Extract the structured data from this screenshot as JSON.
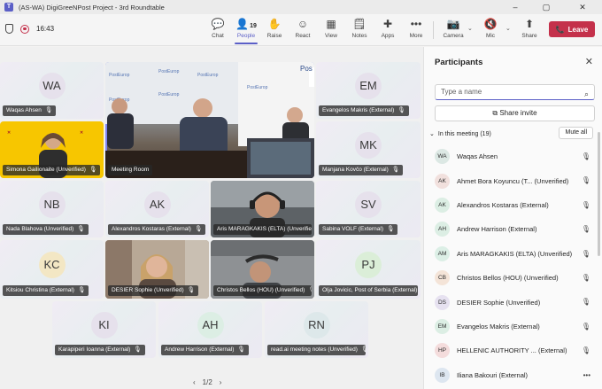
{
  "window": {
    "title": "(AS-WA) DigiGreeNPost Project - 3rd Roundtable",
    "minimize": "–",
    "maximize": "▢",
    "close": "✕"
  },
  "toolbar": {
    "timer": "16:43",
    "buttons": [
      {
        "label": "Chat",
        "icon": "💬"
      },
      {
        "label": "People",
        "icon": "👤",
        "count": "19"
      },
      {
        "label": "Raise",
        "icon": "✋"
      },
      {
        "label": "React",
        "icon": "☺"
      },
      {
        "label": "View",
        "icon": "▦"
      },
      {
        "label": "Notes",
        "icon": "🗒"
      },
      {
        "label": "Apps",
        "icon": "✚"
      },
      {
        "label": "More",
        "icon": "•••"
      },
      {
        "label": "Camera",
        "icon": "📷"
      },
      {
        "label": "Mic",
        "icon": "🔇"
      },
      {
        "label": "Share",
        "icon": "⬆"
      }
    ],
    "leave_label": "Leave",
    "leave_icon": "📞"
  },
  "stage": {
    "tiles": [
      {
        "initials": "WA",
        "name": "Waqas Ahsen"
      },
      {
        "initials": "",
        "name": "Meeting Room"
      },
      {
        "initials": "EM",
        "name": "Evangelos Makris (External)"
      },
      {
        "initials": "",
        "name": "Simona Gailionaite (Unverified)"
      },
      {
        "initials": "MK",
        "name": "Manjana Kovčo (External)"
      },
      {
        "initials": "NB",
        "name": "Nada Blahova (Unverified)"
      },
      {
        "initials": "AK",
        "name": "Alexandros Kostaras (External)"
      },
      {
        "initials": "",
        "name": "Aris MARAGKAKIS (ELTA) (Unverified)"
      },
      {
        "initials": "SV",
        "name": "Sabina VOLF (External)"
      },
      {
        "initials": "KC",
        "name": "Kitsiou Christina (External)"
      },
      {
        "initials": "",
        "name": "DESIER Sophie (Unverified)"
      },
      {
        "initials": "",
        "name": "Christos Bellos (HOU) (Unverified)"
      },
      {
        "initials": "PJ",
        "name": "Olja Jovicic, Post of Serbia (External)"
      },
      {
        "initials": "KI",
        "name": "Karapiperi Ioanna (External)"
      },
      {
        "initials": "AH",
        "name": "Andrew Harrison (External)"
      },
      {
        "initials": "RN",
        "name": "read.ai meeting notes (Unverified)"
      }
    ],
    "pager": {
      "text": "1/2",
      "prev": "‹",
      "next": "›"
    },
    "logos": {
      "posteurop": "PostEurop",
      "pos": "Pos"
    }
  },
  "panel": {
    "title": "Participants",
    "search_placeholder": "Type a name",
    "share_invite": "Share invite",
    "section": "In this meeting (19)",
    "mute_all": "Mute all",
    "participants": [
      {
        "initials": "WA",
        "name": "Waqas Ahsen",
        "color": "#dce8e4"
      },
      {
        "initials": "AK",
        "name": "Ahmet Bora Koyuncu (T... (Unverified)",
        "color": "#f1e0dd"
      },
      {
        "initials": "AK",
        "name": "Alexandros Kostaras (External)",
        "color": "#dceee4"
      },
      {
        "initials": "AH",
        "name": "Andrew Harrison (External)",
        "color": "#dceee4"
      },
      {
        "initials": "AM",
        "name": "Aris MARAGKAKIS (ELTA) (Unverified)",
        "color": "#dcefe6"
      },
      {
        "initials": "CB",
        "name": "Christos Bellos (HOU) (Unverified)",
        "color": "#f4e4d8"
      },
      {
        "initials": "DS",
        "name": "DESIER Sophie (Unverified)",
        "color": "#e6e1f0"
      },
      {
        "initials": "EM",
        "name": "Evangelos Makris (External)",
        "color": "#dceee4"
      },
      {
        "initials": "HP",
        "name": "HELLENIC AUTHORITY ... (External)",
        "color": "#f4dcdc"
      },
      {
        "initials": "IB",
        "name": "Iliana Bakouri (External)",
        "color": "#dde6f0"
      }
    ]
  }
}
